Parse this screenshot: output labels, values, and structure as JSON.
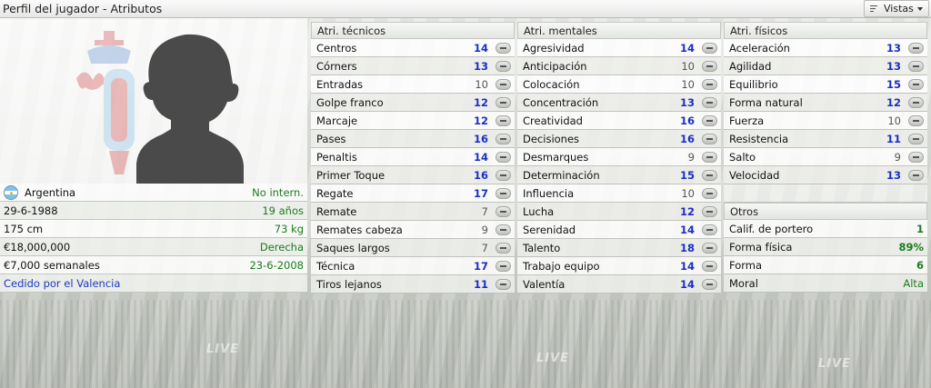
{
  "window": {
    "title": "Perfil del jugador - Atributos",
    "views_label": "Vistas"
  },
  "background": {
    "watermarks": [
      "LIVE",
      "LIVE",
      "LIVE"
    ]
  },
  "profile": {
    "info": [
      {
        "left": "Argentina",
        "right": "No intern.",
        "flag": "argentina-flag-icon"
      },
      {
        "left": "29-6-1988",
        "right": "19 años"
      },
      {
        "left": "175 cm",
        "right": "73 kg"
      },
      {
        "left": "€18,000,000",
        "right": "Derecha"
      },
      {
        "left": "€7,000 semanales",
        "right": "23-6-2008"
      }
    ],
    "loan_text": "Cedido por el Valencia"
  },
  "panels": {
    "technical": {
      "header": "Atri. técnicos",
      "rows": [
        {
          "label": "Centros",
          "value": "14",
          "style": "hi"
        },
        {
          "label": "Córners",
          "value": "13",
          "style": "hi"
        },
        {
          "label": "Entradas",
          "value": "10",
          "style": "lo"
        },
        {
          "label": "Golpe franco",
          "value": "12",
          "style": "hi"
        },
        {
          "label": "Marcaje",
          "value": "12",
          "style": "hi"
        },
        {
          "label": "Pases",
          "value": "16",
          "style": "hi"
        },
        {
          "label": "Penaltis",
          "value": "14",
          "style": "hi"
        },
        {
          "label": "Primer Toque",
          "value": "16",
          "style": "hi"
        },
        {
          "label": "Regate",
          "value": "17",
          "style": "hi"
        },
        {
          "label": "Remate",
          "value": "7",
          "style": "lo"
        },
        {
          "label": "Remates cabeza",
          "value": "9",
          "style": "lo"
        },
        {
          "label": "Saques largos",
          "value": "7",
          "style": "lo"
        },
        {
          "label": "Técnica",
          "value": "17",
          "style": "hi"
        },
        {
          "label": "Tiros lejanos",
          "value": "11",
          "style": "hi"
        }
      ]
    },
    "mental": {
      "header": "Atri. mentales",
      "rows": [
        {
          "label": "Agresividad",
          "value": "14",
          "style": "hi"
        },
        {
          "label": "Anticipación",
          "value": "10",
          "style": "lo"
        },
        {
          "label": "Colocación",
          "value": "10",
          "style": "lo"
        },
        {
          "label": "Concentración",
          "value": "13",
          "style": "hi"
        },
        {
          "label": "Creatividad",
          "value": "16",
          "style": "hi"
        },
        {
          "label": "Decisiones",
          "value": "16",
          "style": "hi"
        },
        {
          "label": "Desmarques",
          "value": "9",
          "style": "lo"
        },
        {
          "label": "Determinación",
          "value": "15",
          "style": "hi"
        },
        {
          "label": "Influencia",
          "value": "10",
          "style": "lo"
        },
        {
          "label": "Lucha",
          "value": "12",
          "style": "hi"
        },
        {
          "label": "Serenidad",
          "value": "14",
          "style": "hi"
        },
        {
          "label": "Talento",
          "value": "18",
          "style": "hi"
        },
        {
          "label": "Trabajo equipo",
          "value": "14",
          "style": "hi"
        },
        {
          "label": "Valentía",
          "value": "14",
          "style": "hi"
        }
      ]
    },
    "physical": {
      "header": "Atri. físicos",
      "rows": [
        {
          "label": "Aceleración",
          "value": "13",
          "style": "hi"
        },
        {
          "label": "Agilidad",
          "value": "13",
          "style": "hi"
        },
        {
          "label": "Equilibrio",
          "value": "15",
          "style": "hi"
        },
        {
          "label": "Forma natural",
          "value": "12",
          "style": "hi"
        },
        {
          "label": "Fuerza",
          "value": "10",
          "style": "lo"
        },
        {
          "label": "Resistencia",
          "value": "11",
          "style": "hi"
        },
        {
          "label": "Salto",
          "value": "9",
          "style": "lo"
        },
        {
          "label": "Velocidad",
          "value": "13",
          "style": "hi"
        }
      ]
    },
    "other": {
      "header": "Otros",
      "rows": [
        {
          "label": "Calif. de portero",
          "value": "1",
          "bold": true
        },
        {
          "label": "Forma física",
          "value": "89%",
          "bold": true
        },
        {
          "label": "Forma",
          "value": "6",
          "bold": true
        },
        {
          "label": "Moral",
          "value": "Alta",
          "bold": false
        }
      ]
    }
  },
  "colors": {
    "high_value": "#1a2fc6",
    "low_value": "#555555",
    "positive_green": "#1e7b1e",
    "link_blue": "#1a3bbf"
  }
}
